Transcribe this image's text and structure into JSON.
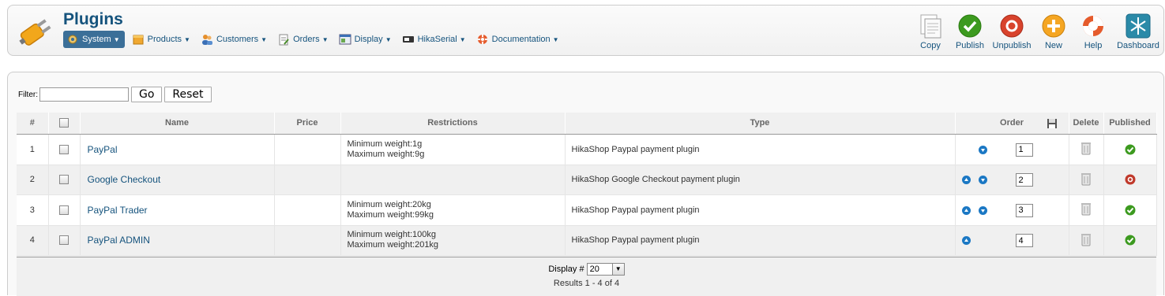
{
  "header": {
    "title": "Plugins",
    "menu": [
      {
        "label": "System",
        "icon": "system-icon",
        "active": true
      },
      {
        "label": "Products",
        "icon": "products-icon"
      },
      {
        "label": "Customers",
        "icon": "customers-icon"
      },
      {
        "label": "Orders",
        "icon": "orders-icon"
      },
      {
        "label": "Display",
        "icon": "display-icon"
      },
      {
        "label": "HikaSerial",
        "icon": "hikaserial-icon"
      },
      {
        "label": "Documentation",
        "icon": "documentation-icon"
      }
    ],
    "actions": {
      "copy": "Copy",
      "publish": "Publish",
      "unpublish": "Unpublish",
      "new": "New",
      "help": "Help",
      "dashboard": "Dashboard"
    }
  },
  "filter": {
    "label": "Filter:",
    "value": "",
    "go_label": "Go",
    "reset_label": "Reset"
  },
  "table": {
    "headers": {
      "num": "#",
      "name": "Name",
      "price": "Price",
      "restrictions": "Restrictions",
      "type": "Type",
      "order": "Order",
      "delete": "Delete",
      "published": "Published"
    },
    "rows": [
      {
        "num": "1",
        "name": "PayPal",
        "price": "",
        "restriction_1": "Minimum weight:1g",
        "restriction_2": "Maximum weight:9g",
        "type": "HikaShop Paypal payment plugin",
        "order": "1",
        "published": true
      },
      {
        "num": "2",
        "name": "Google Checkout",
        "price": "",
        "restriction_1": "",
        "restriction_2": "",
        "type": "HikaShop Google Checkout payment plugin",
        "order": "2",
        "published": false
      },
      {
        "num": "3",
        "name": "PayPal Trader",
        "price": "",
        "restriction_1": "Minimum weight:20kg",
        "restriction_2": "Maximum weight:99kg",
        "type": "HikaShop Paypal payment plugin",
        "order": "3",
        "published": true
      },
      {
        "num": "4",
        "name": "PayPal ADMIN",
        "price": "",
        "restriction_1": "Minimum weight:100kg",
        "restriction_2": "Maximum weight:201kg",
        "type": "HikaShop Paypal payment plugin",
        "order": "4",
        "published": true
      }
    ]
  },
  "pagination": {
    "display_label": "Display #",
    "display_value": "20",
    "results": "Results 1 - 4 of 4"
  },
  "colors": {
    "link": "#15537d",
    "active_menu": "#3b6f98",
    "published": "#3c9a1f",
    "unpublished": "#c0392b",
    "order_arrow": "#1b78c4"
  }
}
